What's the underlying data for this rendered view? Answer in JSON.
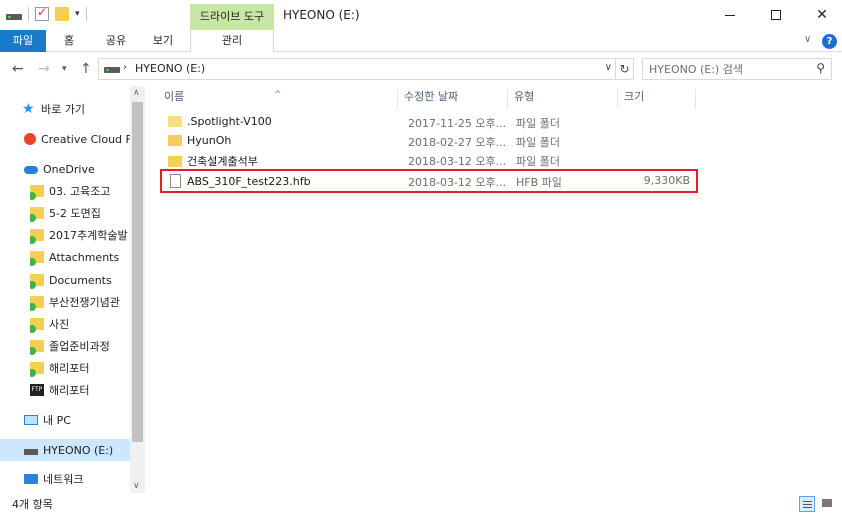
{
  "title_bar": {
    "window_title": "HYEONO (E:)",
    "tool_tab_header": "드라이브 도구",
    "minimize": "—",
    "maximize": "☐",
    "close": "✕"
  },
  "ribbon": {
    "tabs": [
      "파일",
      "홈",
      "공유",
      "보기",
      "관리"
    ],
    "help": "?",
    "expand": "∨"
  },
  "address_bar": {
    "path": "HYEONO (E:)",
    "search_placeholder": "HYEONO (E:) 검색"
  },
  "nav_pane": {
    "items": [
      {
        "label": "바로 가기",
        "icon": "star-icon"
      },
      {
        "label": "Creative Cloud Fil",
        "icon": "creative-cloud-icon"
      },
      {
        "label": "OneDrive",
        "icon": "onedrive-cloud-icon"
      },
      {
        "label": "03. 고육조고",
        "icon": "folder-sync-icon"
      },
      {
        "label": "5-2 도면집",
        "icon": "folder-sync-icon"
      },
      {
        "label": "2017추계학술발",
        "icon": "folder-sync-icon"
      },
      {
        "label": "Attachments",
        "icon": "folder-sync-icon"
      },
      {
        "label": "Documents",
        "icon": "folder-sync-icon"
      },
      {
        "label": "부산전쟁기념관",
        "icon": "folder-sync-icon"
      },
      {
        "label": "사진",
        "icon": "folder-sync-icon"
      },
      {
        "label": "졸업준비과정",
        "icon": "folder-sync-icon"
      },
      {
        "label": "해리포터",
        "icon": "folder-sync-icon"
      },
      {
        "label": "해리포터",
        "icon": "ftp-icon"
      },
      {
        "label": "내 PC",
        "icon": "pc-icon"
      },
      {
        "label": "HYEONO (E:)",
        "icon": "drive-icon",
        "selected": true
      },
      {
        "label": "네트워크",
        "icon": "network-icon"
      }
    ]
  },
  "file_list": {
    "columns": {
      "name": "이름",
      "date": "수정한 날짜",
      "type": "유형",
      "size": "크기"
    },
    "rows": [
      {
        "name": ".Spotlight-V100",
        "date": "2017-11-25 오후...",
        "type": "파일 폴더",
        "size": "",
        "icon": "folder-icon"
      },
      {
        "name": "HyunOh",
        "date": "2018-02-27 오후...",
        "type": "파일 폴더",
        "size": "",
        "icon": "folder-icon"
      },
      {
        "name": "건축설계출석부",
        "date": "2018-03-12 오후...",
        "type": "파일 폴더",
        "size": "",
        "icon": "folder-icon"
      },
      {
        "name": "ABS_310F_test223.hfb",
        "date": "2018-03-12 오후...",
        "type": "HFB 파일",
        "size": "9,330KB",
        "icon": "file-icon",
        "highlighted": true
      }
    ]
  },
  "status_bar": {
    "item_count": "4개 항목"
  },
  "colors": {
    "file_tab": "#1979ca",
    "tool_tab": "#c8e6a4",
    "selection": "#cce8ff",
    "highlight_box": "#e0202c",
    "folder": "#f4cf54"
  }
}
